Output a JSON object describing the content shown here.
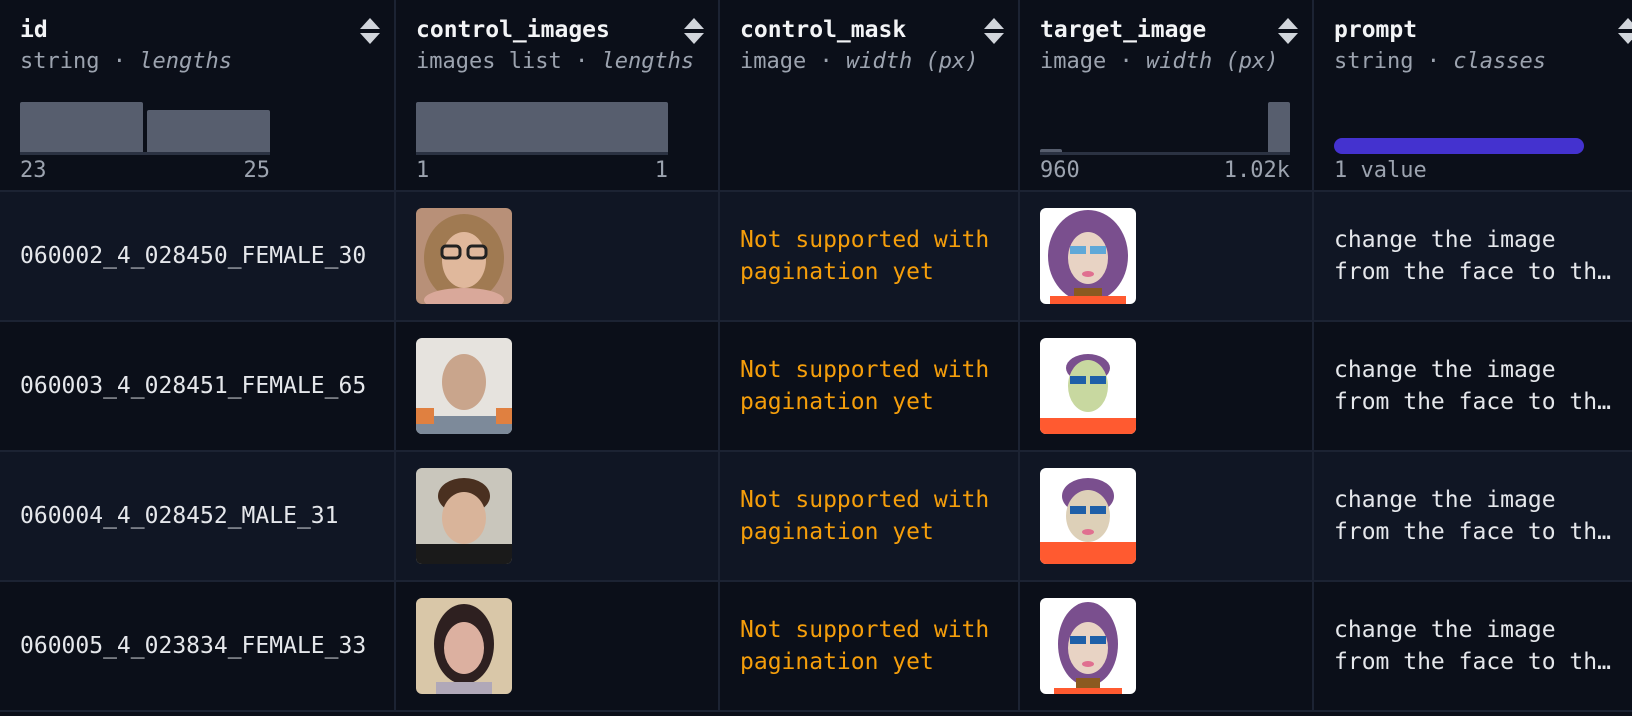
{
  "columns": [
    {
      "name": "id",
      "type": "string",
      "stat": "lengths",
      "range_min": "23",
      "range_max": "25"
    },
    {
      "name": "control_images",
      "type": "images list",
      "stat": "lengths",
      "range_min": "1",
      "range_max": "1"
    },
    {
      "name": "control_mask",
      "type": "image",
      "stat": "width (px)"
    },
    {
      "name": "target_image",
      "type": "image",
      "stat": "width (px)",
      "range_min": "960",
      "range_max": "1.02k"
    },
    {
      "name": "prompt",
      "type": "string",
      "stat": "classes",
      "value_count": "1 value"
    }
  ],
  "type_separator": "·",
  "histograms": {
    "id": [
      0.95,
      0.8
    ],
    "control_images": [
      1.0
    ],
    "target_image": [
      0.05,
      0.95
    ]
  },
  "colors": {
    "background": "#0b0f19",
    "row_alt": "#101624",
    "histogram_bar": "#575e6e",
    "class_pill": "#4432cf",
    "warning_text": "#f59e0b"
  },
  "rows": [
    {
      "id": "060002_4_028450_FEMALE_30",
      "control_mask": "Not supported with\npagination yet",
      "prompt": "change the image\nfrom the face to th…"
    },
    {
      "id": "060003_4_028451_FEMALE_65",
      "control_mask": "Not supported with\npagination yet",
      "prompt": "change the image\nfrom the face to th…"
    },
    {
      "id": "060004_4_028452_MALE_31",
      "control_mask": "Not supported with\npagination yet",
      "prompt": "change the image\nfrom the face to th…"
    },
    {
      "id": "060005_4_023834_FEMALE_33",
      "control_mask": "Not supported with\npagination yet",
      "prompt": "change the image\nfrom the face to th…"
    }
  ]
}
